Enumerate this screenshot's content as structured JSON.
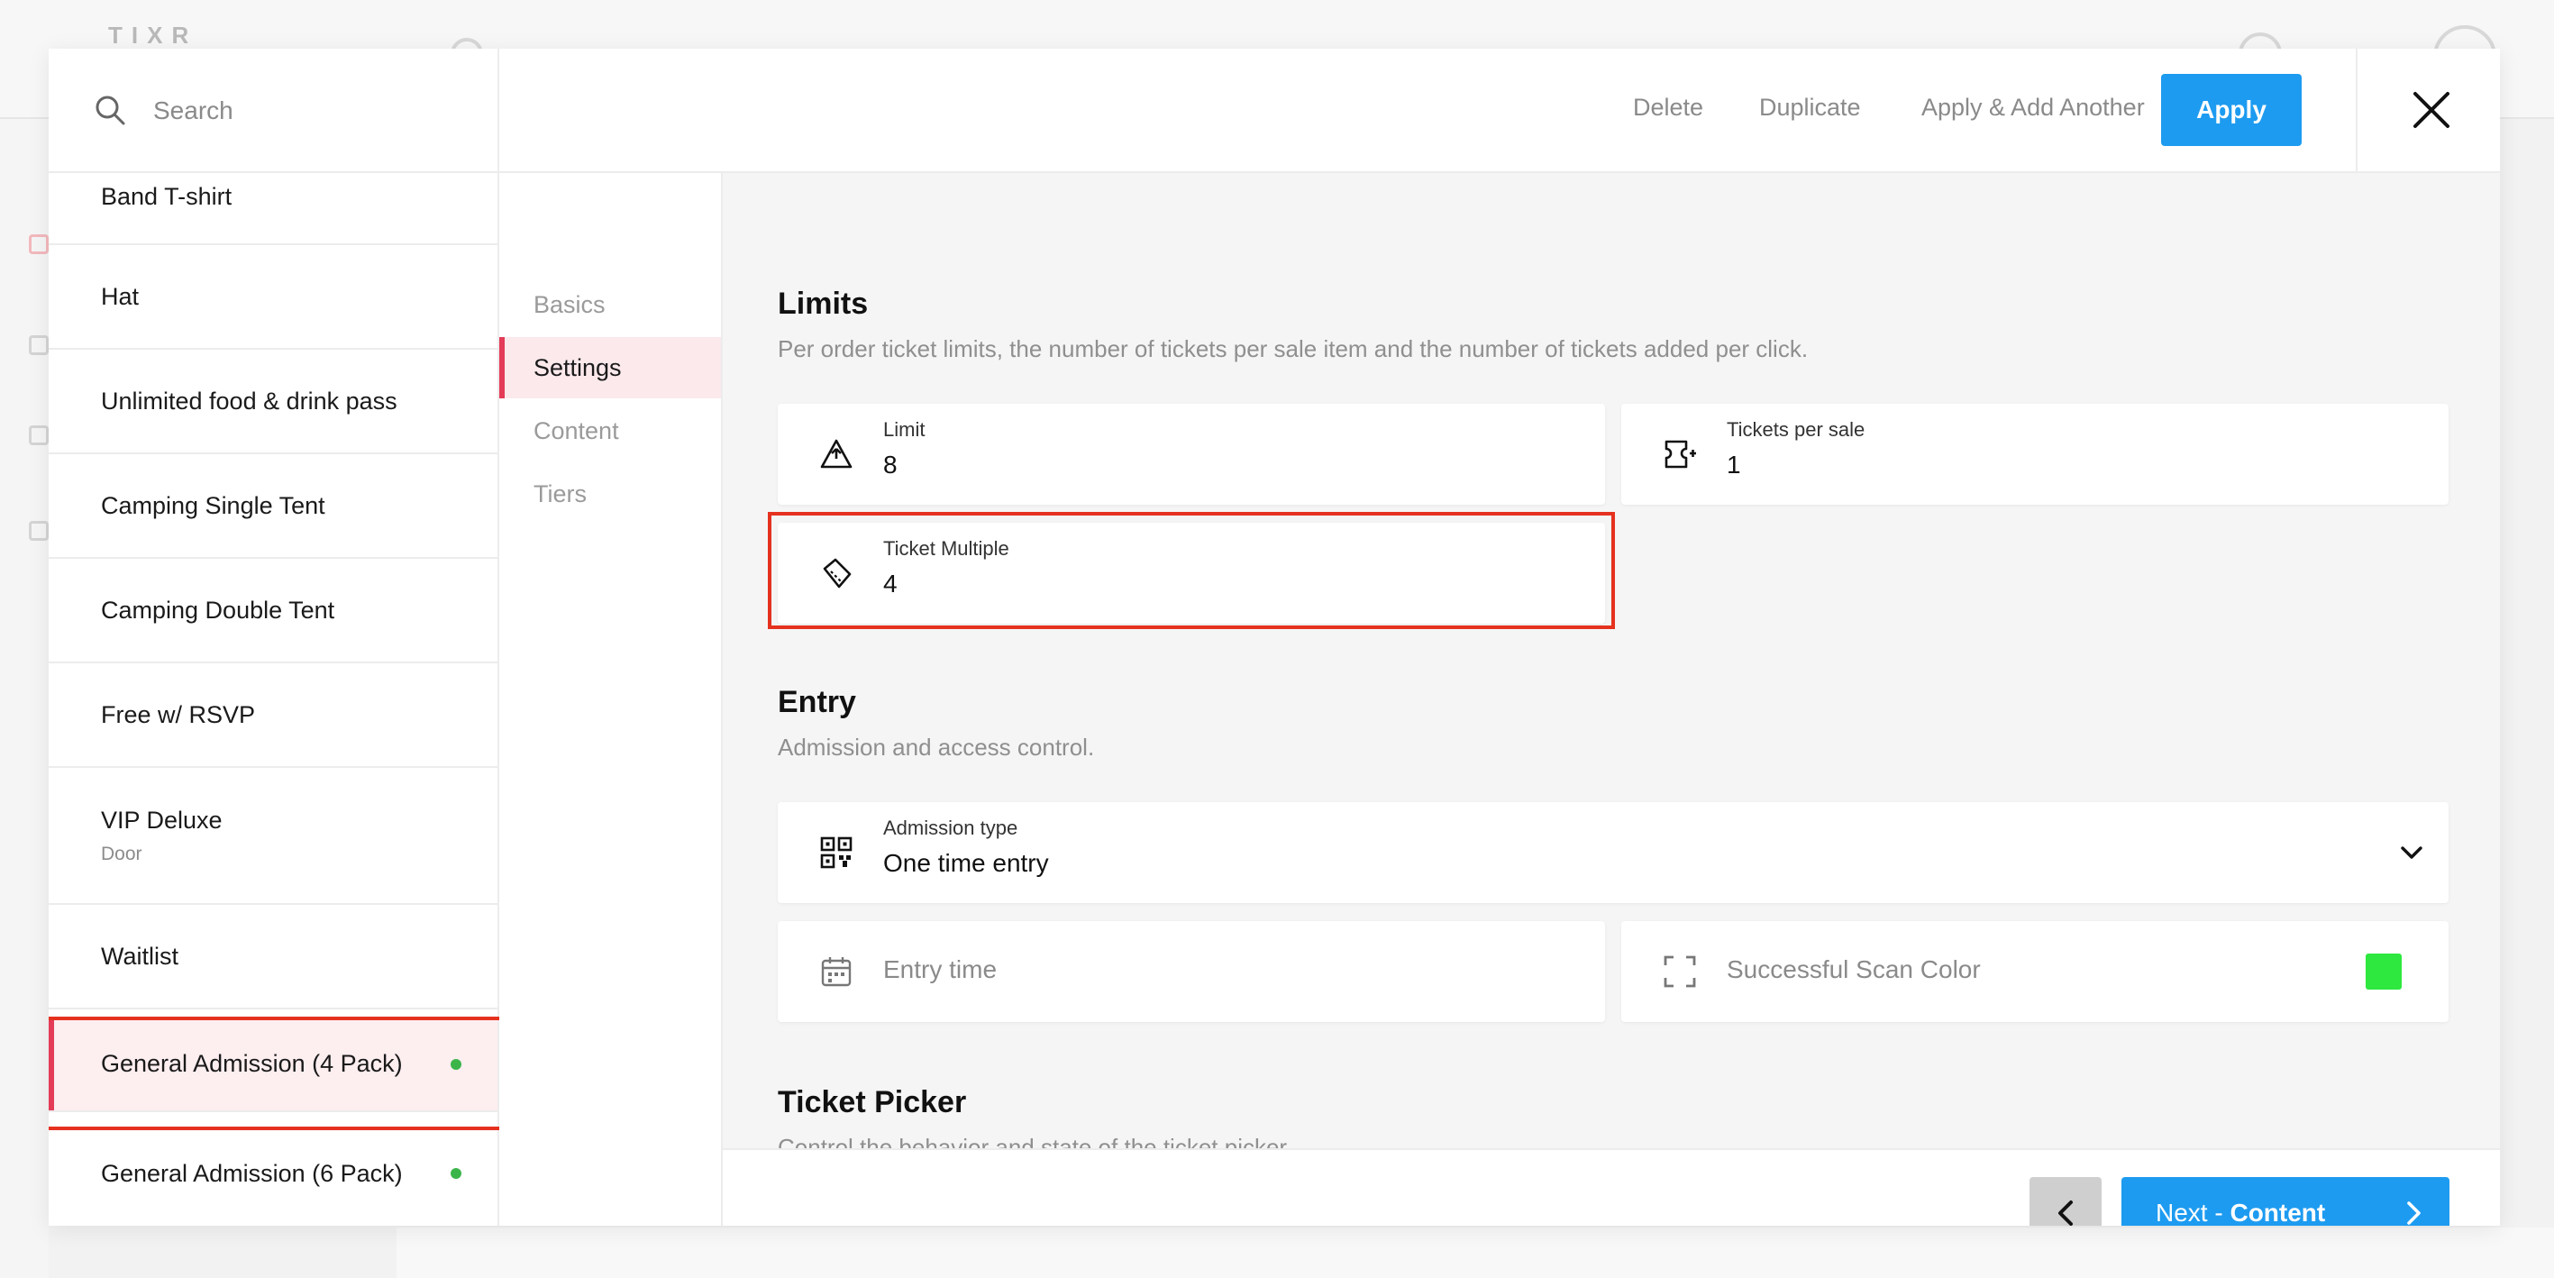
{
  "background": {
    "logo": "TIXR"
  },
  "search": {
    "placeholder": "Search"
  },
  "items": [
    {
      "name": "Band T-shirt",
      "sub": "",
      "dot": false
    },
    {
      "name": "Hat",
      "sub": "",
      "dot": false
    },
    {
      "name": "Unlimited food & drink pass",
      "sub": "",
      "dot": false
    },
    {
      "name": "Camping Single Tent",
      "sub": "",
      "dot": false
    },
    {
      "name": "Camping Double Tent",
      "sub": "",
      "dot": false
    },
    {
      "name": "Free w/ RSVP",
      "sub": "",
      "dot": false
    },
    {
      "name": "VIP Deluxe",
      "sub": "Door",
      "dot": false
    },
    {
      "name": "Waitlist",
      "sub": "",
      "dot": false
    },
    {
      "name": "General Admission (4 Pack)",
      "sub": "",
      "dot": true,
      "selected": true
    },
    {
      "name": "General Admission (6 Pack)",
      "sub": "",
      "dot": true
    }
  ],
  "tabs": [
    "Basics",
    "Settings",
    "Content",
    "Tiers"
  ],
  "active_tab": "Settings",
  "header": {
    "delete": "Delete",
    "duplicate": "Duplicate",
    "apply_add": "Apply & Add Another",
    "apply": "Apply"
  },
  "limits": {
    "title": "Limits",
    "desc": "Per order ticket limits, the number of tickets per sale item and the number of tickets added per click.",
    "limit_label": "Limit",
    "limit_value": "8",
    "per_sale_label": "Tickets per sale",
    "per_sale_value": "1",
    "multiple_label": "Ticket Multiple",
    "multiple_value": "4"
  },
  "entry": {
    "title": "Entry",
    "desc": "Admission and access control.",
    "admission_label": "Admission type",
    "admission_value": "One time entry",
    "entry_time_placeholder": "Entry time",
    "scan_color_label": "Successful Scan Color",
    "scan_color": "#2ee83f"
  },
  "picker": {
    "title": "Ticket Picker",
    "desc": "Control the behavior and state of the ticket picker."
  },
  "footer": {
    "next_prefix": "Next - ",
    "next_target": "Content"
  },
  "colors": {
    "accent": "#1d9bf0",
    "selected": "#e43b57",
    "highlight": "#e5321f",
    "status": "#3bb54a"
  }
}
